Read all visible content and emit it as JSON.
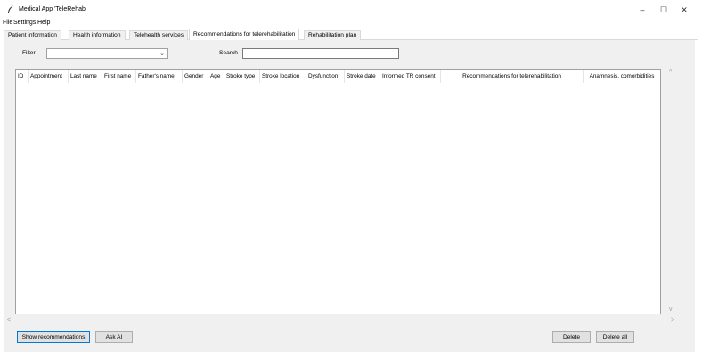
{
  "window": {
    "title": "Medical App 'TeleRehab'",
    "minimize": "–",
    "maximize": "☐",
    "close": "✕"
  },
  "menu": [
    "File",
    "Settings",
    "Help"
  ],
  "tabs": [
    "Patient information",
    "Health information",
    "Telehealth services",
    "Recommendations for telerehabilitation",
    "Rehabilitation plan"
  ],
  "active_tab": "Recommendations for telerehabilitation",
  "filter": {
    "label": "Filter",
    "value": ""
  },
  "search": {
    "label": "Search",
    "value": ""
  },
  "table": {
    "columns": [
      "ID",
      "Appointment",
      "Last name",
      "First name",
      "Father's name",
      "Gender",
      "Age",
      "Stroke type",
      "Stroke location",
      "Dysfunction",
      "Stroke date",
      "Informed TR consent",
      "Recommendations for telerehabilitation",
      "Anamnesis, comorbidities"
    ],
    "rows": []
  },
  "buttons": {
    "show_recommendations": "Show recommendations",
    "ask_ai": "Ask AI",
    "delete": "Delete",
    "delete_all": "Delete all"
  }
}
